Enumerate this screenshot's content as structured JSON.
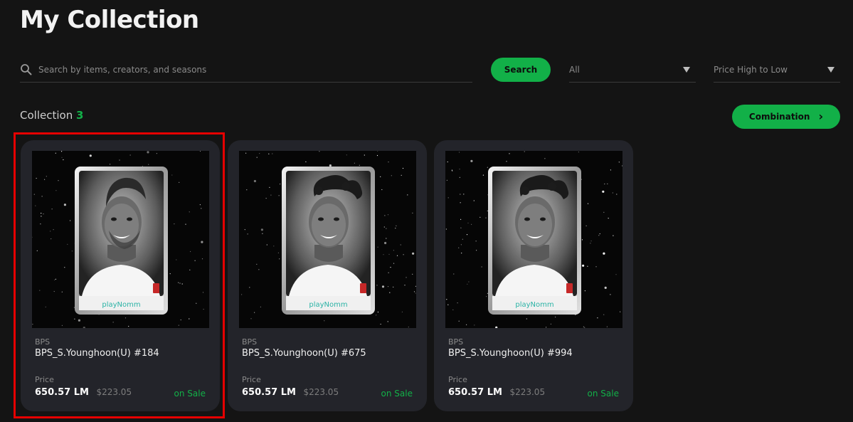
{
  "page": {
    "title": "My Collection"
  },
  "search": {
    "placeholder": "Search by items, creators, and seasons",
    "value": "",
    "button_label": "Search"
  },
  "filters": {
    "category": {
      "selected": "All"
    },
    "sort": {
      "selected": "Price High to Low"
    }
  },
  "collection": {
    "label": "Collection",
    "count": "3",
    "combination_label": "Combination"
  },
  "cards": [
    {
      "brand": "BPS",
      "name": "BPS_S.Younghoon(U) #184",
      "price_label": "Price",
      "price": "650.57 LM",
      "price_usd": "$223.05",
      "status": "on Sale",
      "card_logo": "playNomm",
      "portrait": "man"
    },
    {
      "brand": "BPS",
      "name": "BPS_S.Younghoon(U) #675",
      "price_label": "Price",
      "price": "650.57 LM",
      "price_usd": "$223.05",
      "status": "on Sale",
      "card_logo": "playNomm",
      "portrait": "woman"
    },
    {
      "brand": "BPS",
      "name": "BPS_S.Younghoon(U) #994",
      "price_label": "Price",
      "price": "650.57 LM",
      "price_usd": "$223.05",
      "status": "on Sale",
      "card_logo": "playNomm",
      "portrait": "woman"
    }
  ],
  "selection": {
    "highlighted_card_index": 0,
    "color": "#e60000"
  },
  "colors": {
    "accent": "#12b048",
    "background": "#141414",
    "card": "#23242a"
  },
  "icons": {
    "search": "search-icon",
    "filter_caret": "caret-down-icon",
    "combination": "chevron-right-icon"
  }
}
